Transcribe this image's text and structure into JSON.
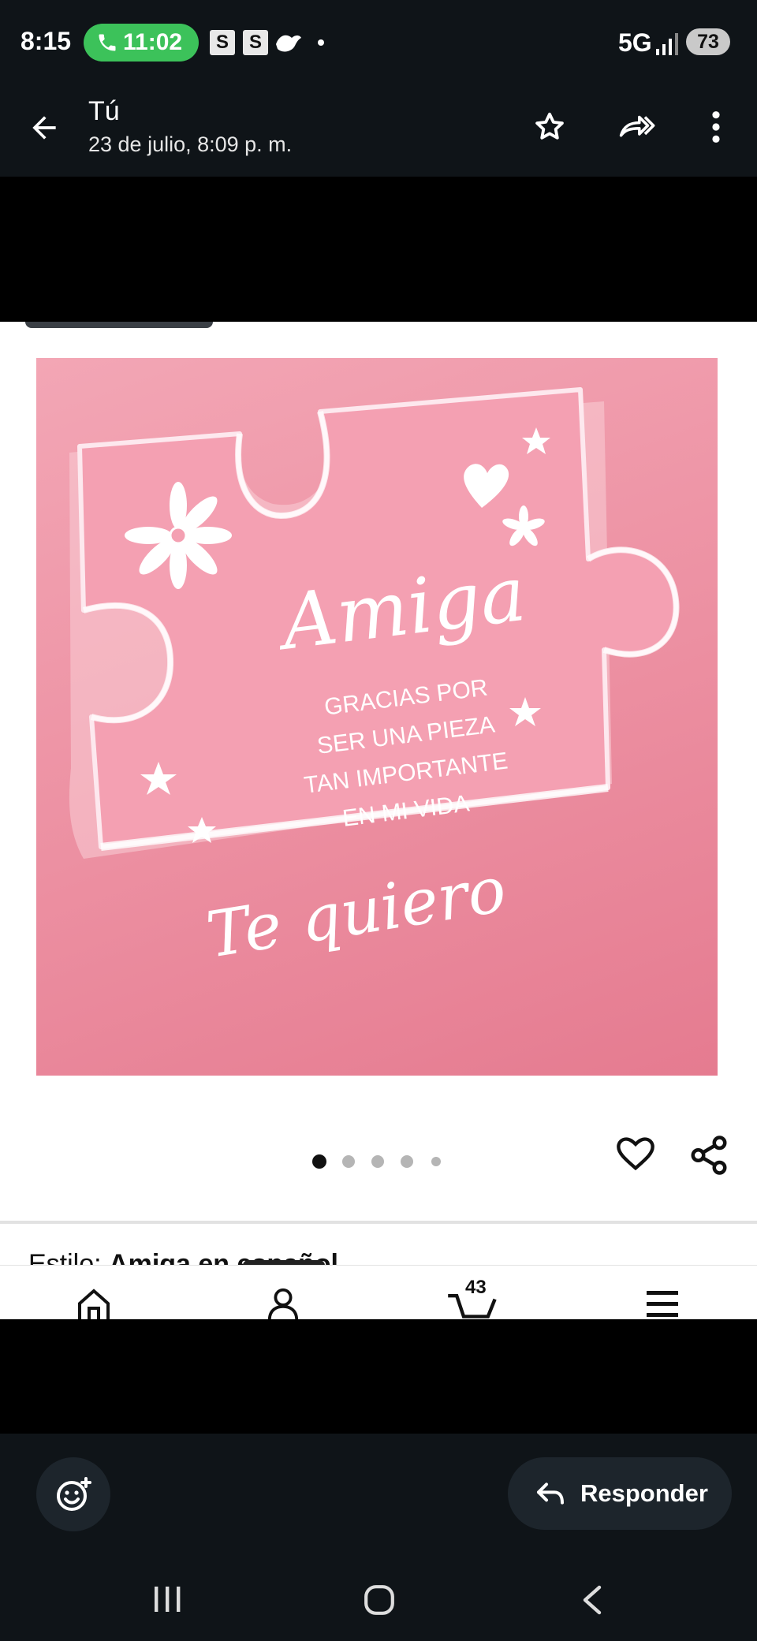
{
  "status_bar": {
    "time": "8:15",
    "call_timer": "11:02",
    "notif_1": "S",
    "notif_2": "S",
    "network": "5G",
    "battery": "73"
  },
  "header": {
    "sender": "Tú",
    "date": "23 de julio, 8:09 p. m.",
    "icons": [
      "back-arrow-icon",
      "star-icon",
      "forward-icon",
      "more-vert-icon"
    ]
  },
  "product": {
    "image_text": {
      "title": "Amiga",
      "line1": "GRACIAS POR",
      "line2": "SER UNA PIEZA",
      "line3": "TAN IMPORTANTE",
      "line4": "EN MI VIDA",
      "closing": "Te quiero"
    },
    "carousel": {
      "count": 5,
      "active": 0
    },
    "style_label": "Estilo:",
    "style_value": "Amiga en español",
    "cart_count": "43"
  },
  "footer": {
    "reply_label": "Responder"
  },
  "colors": {
    "app_bg": "#0f1418",
    "call_pill": "#3cc25a",
    "photo_pink": "#ec8fa1"
  }
}
